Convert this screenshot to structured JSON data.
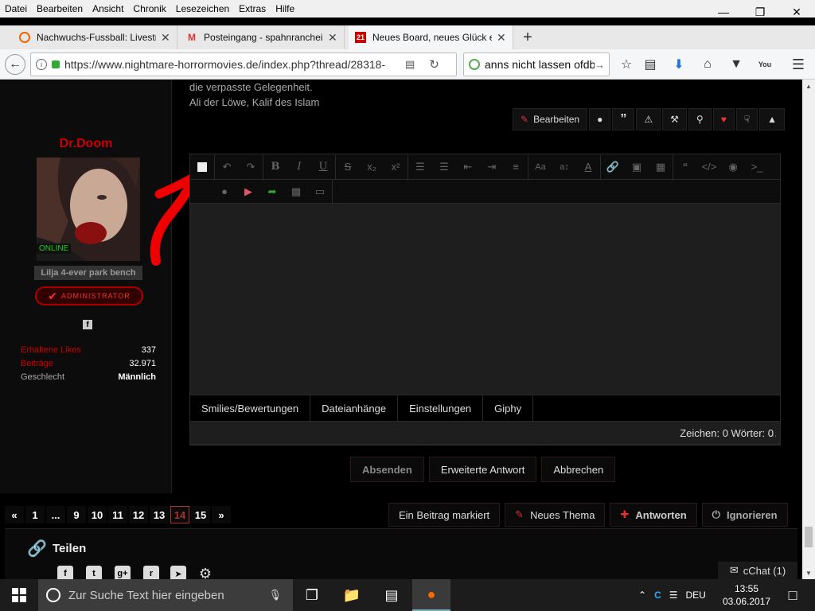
{
  "menu": [
    "Datei",
    "Bearbeiten",
    "Ansicht",
    "Chronik",
    "Lesezeichen",
    "Extras",
    "Hilfe"
  ],
  "tabs": [
    {
      "label": "Nachwuchs-Fussball: Livestream"
    },
    {
      "label": "Posteingang - spahnrancheinfo"
    },
    {
      "label": "Neues Board, neues Glück e.V."
    }
  ],
  "url": "https://www.nightmare-horrormovies.de/index.php?thread/28318-",
  "search_value": "anns nicht lassen ofdb",
  "quote_lines": [
    "die verpasste Gelegenheit.",
    "Ali der Löwe, Kalif des Islam"
  ],
  "post_actions": {
    "edit": "Bearbeiten"
  },
  "user": {
    "name": "Dr.Doom",
    "status": "ONLINE",
    "title": "Lilja 4-ever park bench",
    "badge": "ADMINISTRATOR",
    "stats": [
      {
        "key": "Erhaltene Likes",
        "value": "337"
      },
      {
        "key": "Beiträge",
        "value": "32.971"
      },
      {
        "key": "Geschlecht",
        "value": "Männlich"
      }
    ]
  },
  "editor_tabs": [
    "Smilies/Bewertungen",
    "Dateianhänge",
    "Einstellungen",
    "Giphy"
  ],
  "counter": "Zeichen: 0 Wörter: 0",
  "form_buttons": {
    "submit": "Absenden",
    "extended": "Erweiterte Antwort",
    "cancel": "Abbrechen"
  },
  "pagination": [
    "«",
    "1",
    "...",
    "9",
    "10",
    "11",
    "12",
    "13",
    "14",
    "15",
    "»"
  ],
  "current_page": "14",
  "thread_buttons": {
    "marked": "Ein Beitrag markiert",
    "new_topic": "Neues Thema",
    "reply": "Antworten",
    "ignore": "Ignorieren"
  },
  "share_title": "Teilen",
  "cchat": "cChat (1)",
  "taskbar": {
    "search_placeholder": "Zur Suche Text hier eingeben",
    "lang": "DEU",
    "time": "13:55",
    "date": "03.06.2017"
  }
}
